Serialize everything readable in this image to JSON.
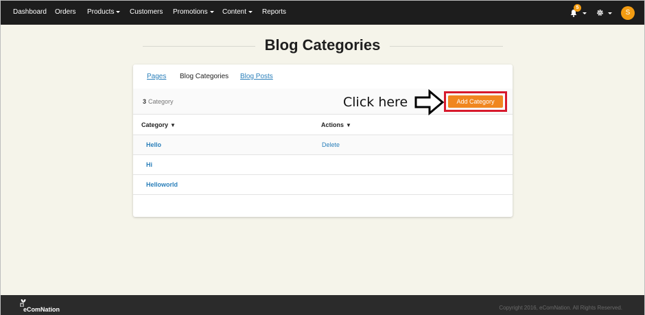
{
  "nav": {
    "items": [
      "Dashboard",
      "Orders",
      "Products",
      "Customers",
      "Promotions",
      "Content",
      "Reports"
    ],
    "notification_count": "5",
    "avatar_initial": "S"
  },
  "page": {
    "title": "Blog Categories"
  },
  "tabs": {
    "pages": "Pages",
    "blog_categories": "Blog Categories",
    "blog_posts": "Blog Posts"
  },
  "toolbar": {
    "count": "3",
    "count_label": "Category",
    "annotation": "Click here",
    "add_button": "Add Category"
  },
  "table": {
    "headers": [
      "Category",
      "Actions"
    ],
    "rows": [
      {
        "name": "Hello",
        "action": "Delete"
      },
      {
        "name": "Hi",
        "action": ""
      },
      {
        "name": "Helloworld",
        "action": ""
      }
    ]
  },
  "footer": {
    "brand": "eComNation",
    "copyright": "Copyright 2016, eComNation. All Rights Reserved."
  },
  "colors": {
    "accent": "#f0861f",
    "highlight_border": "#d7192c",
    "link": "#2a7fba",
    "nav_bg": "#1d1d1d",
    "page_bg": "#f5f4ea"
  }
}
